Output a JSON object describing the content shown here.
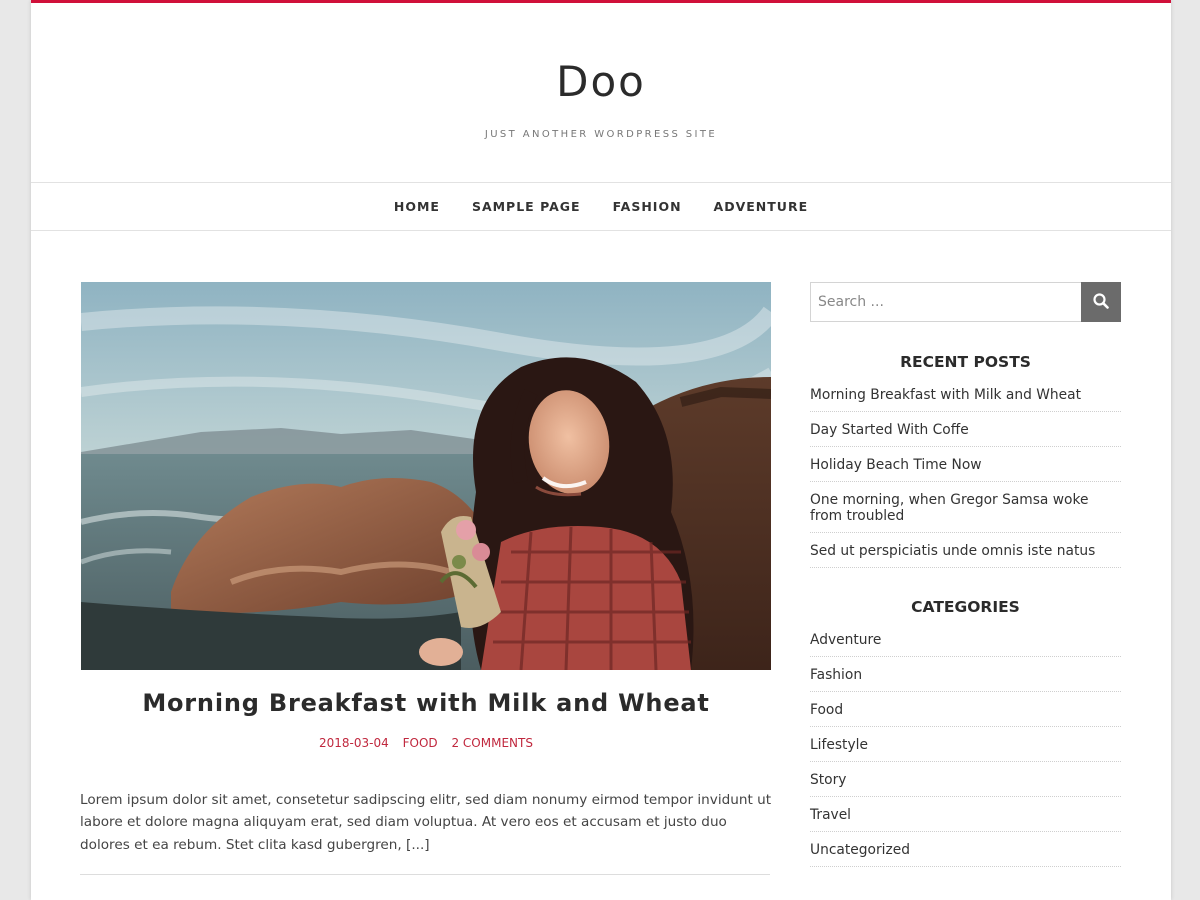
{
  "site": {
    "title": "Doo",
    "description": "Just another WordPress site"
  },
  "nav": {
    "items": [
      {
        "label": "HOME"
      },
      {
        "label": "SAMPLE PAGE"
      },
      {
        "label": "FASHION"
      },
      {
        "label": "ADVENTURE"
      }
    ]
  },
  "post": {
    "image_alt": "Woman with curly hair smiling holding flowers by a rocky coastline",
    "title": "Morning Breakfast with Milk and Wheat",
    "date": "2018-03-04",
    "category": "FOOD",
    "comments": "2 COMMENTS",
    "excerpt": "Lorem ipsum dolor sit amet, consetetur sadipscing elitr, sed diam nonumy eirmod tempor invidunt ut labore et dolore magna aliquyam erat, sed diam voluptua. At vero eos et accusam et justo duo dolores et ea rebum. Stet clita kasd gubergren, [...]"
  },
  "sidebar": {
    "search": {
      "placeholder": "Search ...",
      "button_icon": "search-icon"
    },
    "recent_posts": {
      "title": "RECENT POSTS",
      "items": [
        "Morning Breakfast with Milk and Wheat",
        "Day Started With Coffe",
        "Holiday Beach Time Now",
        "One morning, when Gregor Samsa woke from troubled",
        "Sed ut perspiciatis unde omnis iste natus"
      ]
    },
    "categories": {
      "title": "CATEGORIES",
      "items": [
        "Adventure",
        "Fashion",
        "Food",
        "Lifestyle",
        "Story",
        "Travel",
        "Uncategorized"
      ]
    }
  },
  "colors": {
    "accent": "#d0103a",
    "meta": "#c0283e",
    "search_button": "#6b6b6b"
  }
}
